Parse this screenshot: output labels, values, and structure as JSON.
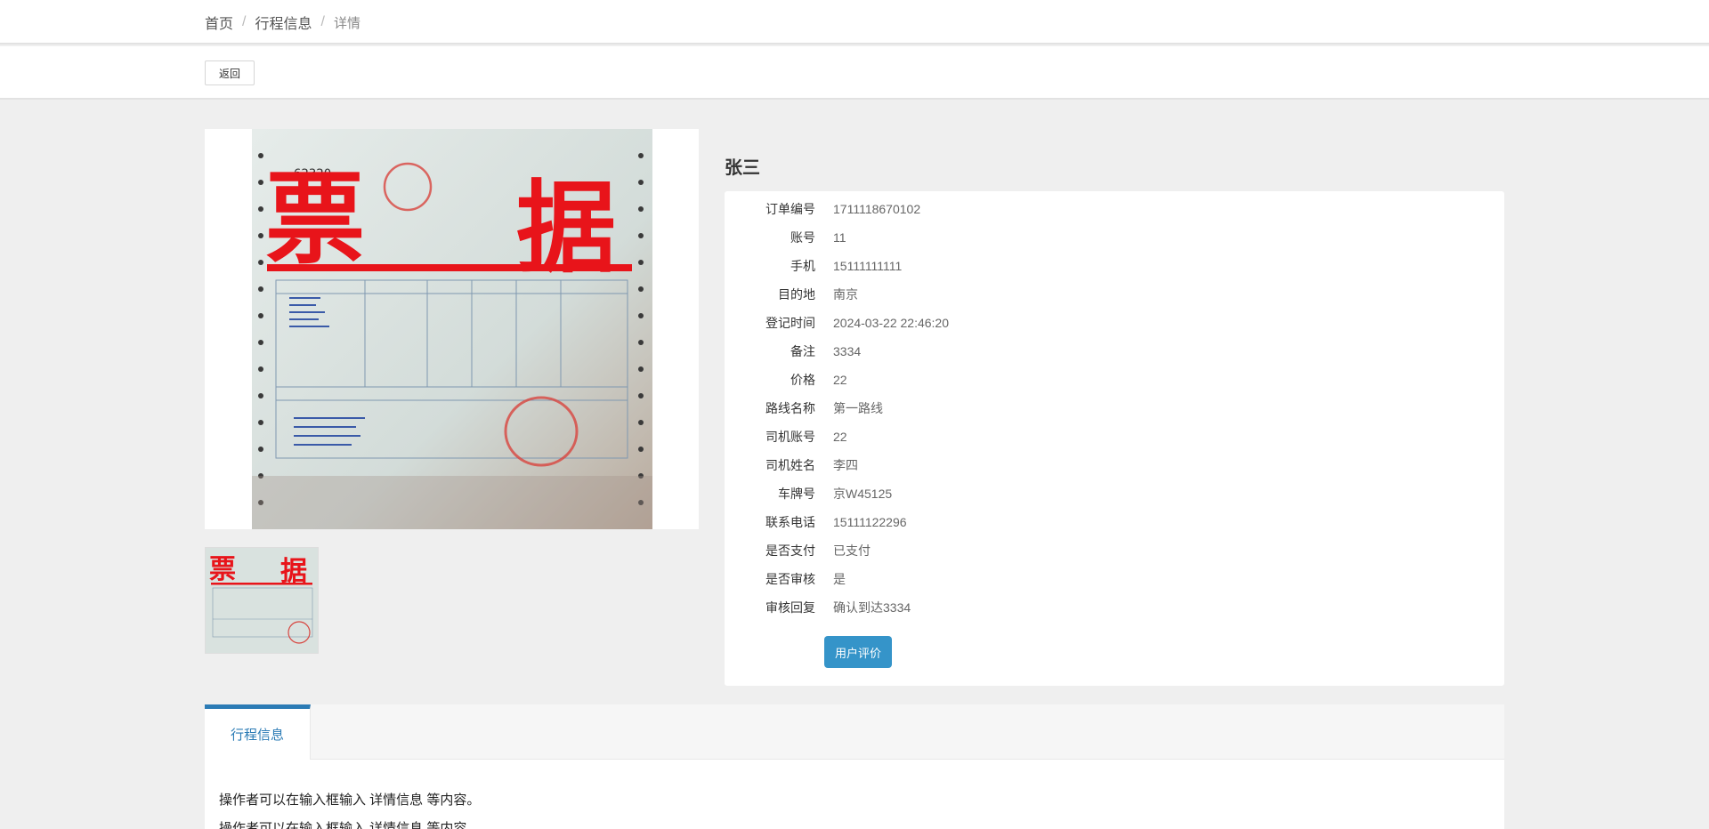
{
  "breadcrumb": {
    "home": "首页",
    "section": "行程信息",
    "current": "详情"
  },
  "actions": {
    "back_label": "返回"
  },
  "detail": {
    "name": "张三",
    "fields": [
      {
        "label": "订单编号",
        "value": "1711118670102"
      },
      {
        "label": "账号",
        "value": "11"
      },
      {
        "label": "手机",
        "value": "15111111111"
      },
      {
        "label": "目的地",
        "value": "南京"
      },
      {
        "label": "登记时间",
        "value": "2024-03-22 22:46:20"
      },
      {
        "label": "备注",
        "value": "3334"
      },
      {
        "label": "价格",
        "value": "22"
      },
      {
        "label": "路线名称",
        "value": "第一路线"
      },
      {
        "label": "司机账号",
        "value": "22"
      },
      {
        "label": "司机姓名",
        "value": "李四"
      },
      {
        "label": "车牌号",
        "value": "京W45125"
      },
      {
        "label": "联系电话",
        "value": "15111122296"
      },
      {
        "label": "是否支付",
        "value": "已支付"
      },
      {
        "label": "是否审核",
        "value": "是"
      },
      {
        "label": "审核回复",
        "value": "确认到达3334"
      }
    ],
    "rate_label": "用户评价"
  },
  "image": {
    "stamp_text_left": "票",
    "stamp_text_right": "据",
    "receipt_number": "62320"
  },
  "tabs": {
    "active_label": "行程信息"
  },
  "content": {
    "line1": "操作者可以在输入框输入  详情信息  等内容。",
    "line2": "操作者可以在输入框输入  详情信息  等内容。"
  },
  "colors": {
    "accent": "#2b7bb5",
    "button": "#3594c9",
    "stamp_red": "#e8141a"
  }
}
